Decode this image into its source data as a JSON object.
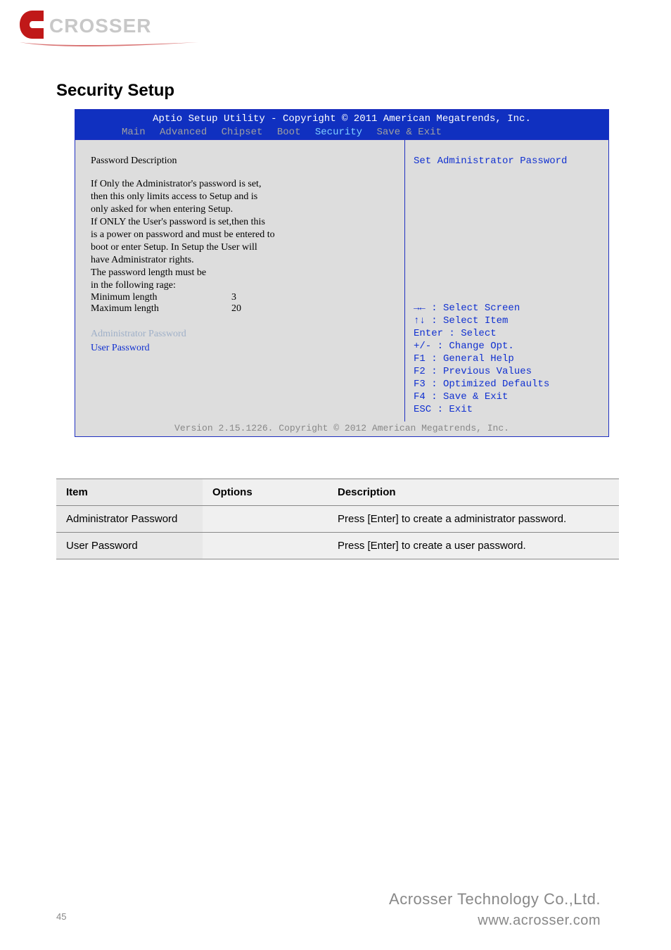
{
  "logo": {
    "text_alt": "ACROSSER",
    "colors": {
      "red": "#c01818",
      "gray": "#c8c8c8"
    }
  },
  "section_title": "Security Setup",
  "bios": {
    "header_line": "Aptio Setup Utility - Copyright © 2011 American Megatrends, Inc.",
    "tabs": {
      "main": "Main",
      "advanced": "Advanced",
      "chipset": "Chipset",
      "boot": "Boot",
      "security": "Security",
      "save_exit": "Save & Exit"
    },
    "active_tab": "security",
    "left": {
      "title": "Password Description",
      "body_lines": [
        "If Only the Administrator's password is set,",
        "then this only limits access to Setup and is",
        "only asked for when entering Setup.",
        "If ONLY the User's password is set,then this",
        "is a power on password and must be entered to",
        "boot or enter Setup. In Setup the User will",
        "have Administrator rights.",
        "The password length must be",
        "in the following rage:"
      ],
      "min_length_label": "Minimum length",
      "min_length_value": "3",
      "max_length_label": "Maximum length",
      "max_length_value": "20",
      "admin_item": "Administrator Password",
      "user_item": "User Password"
    },
    "right": {
      "context_help": "Set Administrator Password",
      "keys": [
        "→← : Select Screen",
        "↑↓ : Select Item",
        "Enter : Select",
        "+/- : Change Opt.",
        "F1 : General Help",
        "F2 : Previous Values",
        "F3 : Optimized Defaults",
        "F4 : Save & Exit",
        "ESC : Exit"
      ]
    },
    "footer_line": "Version 2.15.1226. Copyright © 2012 American Megatrends, Inc."
  },
  "table": {
    "headers": {
      "item": "Item",
      "options": "Options",
      "description": "Description"
    },
    "rows": [
      {
        "item": "Administrator Password",
        "options": "",
        "description": "Press [Enter] to create a administrator password."
      },
      {
        "item": "User Password",
        "options": "",
        "description": "Press [Enter] to create a user password."
      }
    ]
  },
  "footer": {
    "company": "Acrosser Technology Co.,Ltd.",
    "url": "www.acrosser.com",
    "page_no": "45"
  }
}
